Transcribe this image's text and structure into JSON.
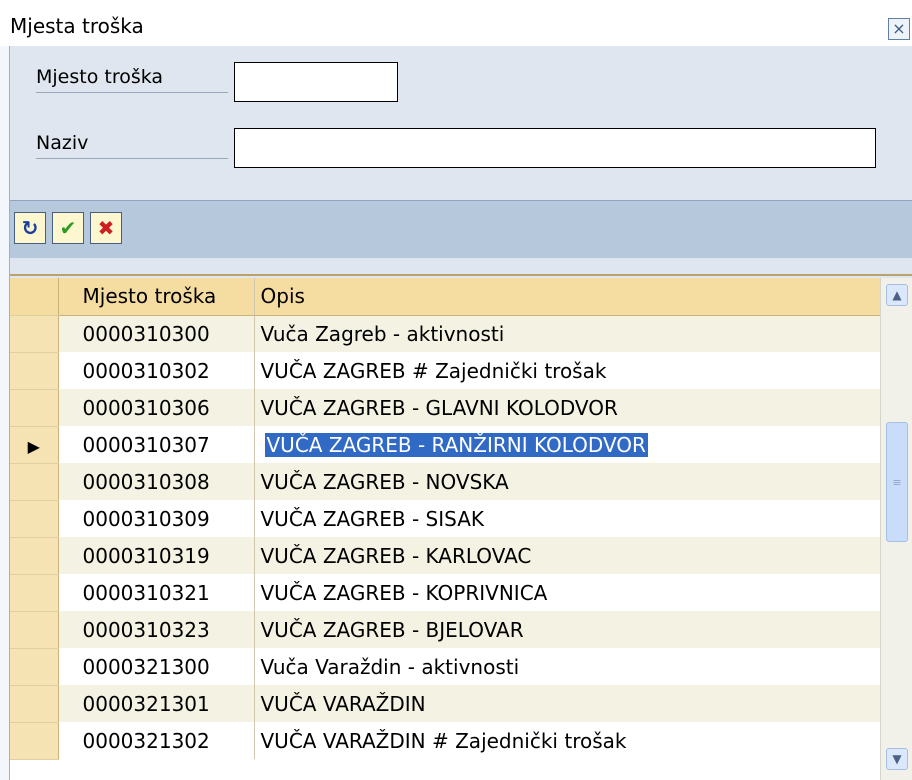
{
  "dialog": {
    "title": "Mjesta troška",
    "close_glyph": "×"
  },
  "form": {
    "cost_center_label": "Mjesto troška",
    "cost_center_value": "",
    "name_label": "Naziv",
    "name_value": ""
  },
  "toolbar": {
    "refresh_glyph": "↻",
    "confirm_glyph": "✔",
    "cancel_glyph": "✖"
  },
  "table": {
    "columns": [
      "Mjesto troška",
      "Opis"
    ],
    "rows": [
      {
        "code": "0000310300",
        "desc": "Vuča Zagreb - aktivnosti"
      },
      {
        "code": "0000310302",
        "desc": "VUČA ZAGREB # Zajednički trošak"
      },
      {
        "code": "0000310306",
        "desc": "VUČA ZAGREB - GLAVNI KOLODVOR"
      },
      {
        "code": "0000310307",
        "desc": "VUČA ZAGREB - RANŽIRNI KOLODVOR"
      },
      {
        "code": "0000310308",
        "desc": "VUČA ZAGREB - NOVSKA"
      },
      {
        "code": "0000310309",
        "desc": "VUČA ZAGREB - SISAK"
      },
      {
        "code": "0000310319",
        "desc": "VUČA ZAGREB - KARLOVAC"
      },
      {
        "code": "0000310321",
        "desc": "VUČA ZAGREB - KOPRIVNICA"
      },
      {
        "code": "0000310323",
        "desc": "VUČA ZAGREB - BJELOVAR"
      },
      {
        "code": "0000321300",
        "desc": "Vuča Varaždin - aktivnosti"
      },
      {
        "code": "0000321301",
        "desc": "VUČA VARAŽDIN"
      },
      {
        "code": "0000321302",
        "desc": "VUČA VARAŽDIN # Zajednički trošak"
      }
    ],
    "current_row_marker": "▶"
  },
  "scrollbar": {
    "up_glyph": "▲",
    "down_glyph": "▼",
    "thumb_glyph": "≡"
  },
  "colors": {
    "header_bg": "#f5dca1",
    "toolbar_bg": "#b6c8dc",
    "selection": "#316ac5"
  }
}
